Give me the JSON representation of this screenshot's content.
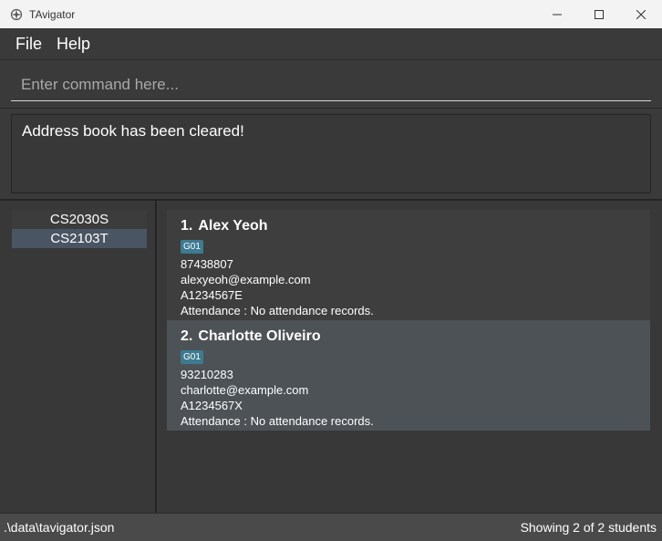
{
  "window": {
    "title": "TAvigator"
  },
  "menu": {
    "items": [
      "File",
      "Help"
    ]
  },
  "command": {
    "placeholder": "Enter command here..."
  },
  "result": {
    "message": "Address book has been cleared!"
  },
  "classes": {
    "items": [
      "CS2030S",
      "CS2103T"
    ],
    "selected": "CS2103T"
  },
  "students": [
    {
      "index": "1.",
      "name": "Alex Yeoh",
      "tag": "G01",
      "phone": "87438807",
      "email": "alexyeoh@example.com",
      "id": "A1234567E",
      "attendance": "Attendance : No attendance records."
    },
    {
      "index": "2.",
      "name": "Charlotte Oliveiro",
      "tag": "G01",
      "phone": "93210283",
      "email": "charlotte@example.com",
      "id": "A1234567X",
      "attendance": "Attendance : No attendance records."
    }
  ],
  "status": {
    "file_path": ".\\data\\tavigator.json",
    "summary": "Showing 2 of 2 students"
  },
  "colors": {
    "background": "#3a3a3a",
    "tag": "#3e7b91",
    "selected_class": "#4a5563",
    "selected_card": "#4d5256"
  }
}
